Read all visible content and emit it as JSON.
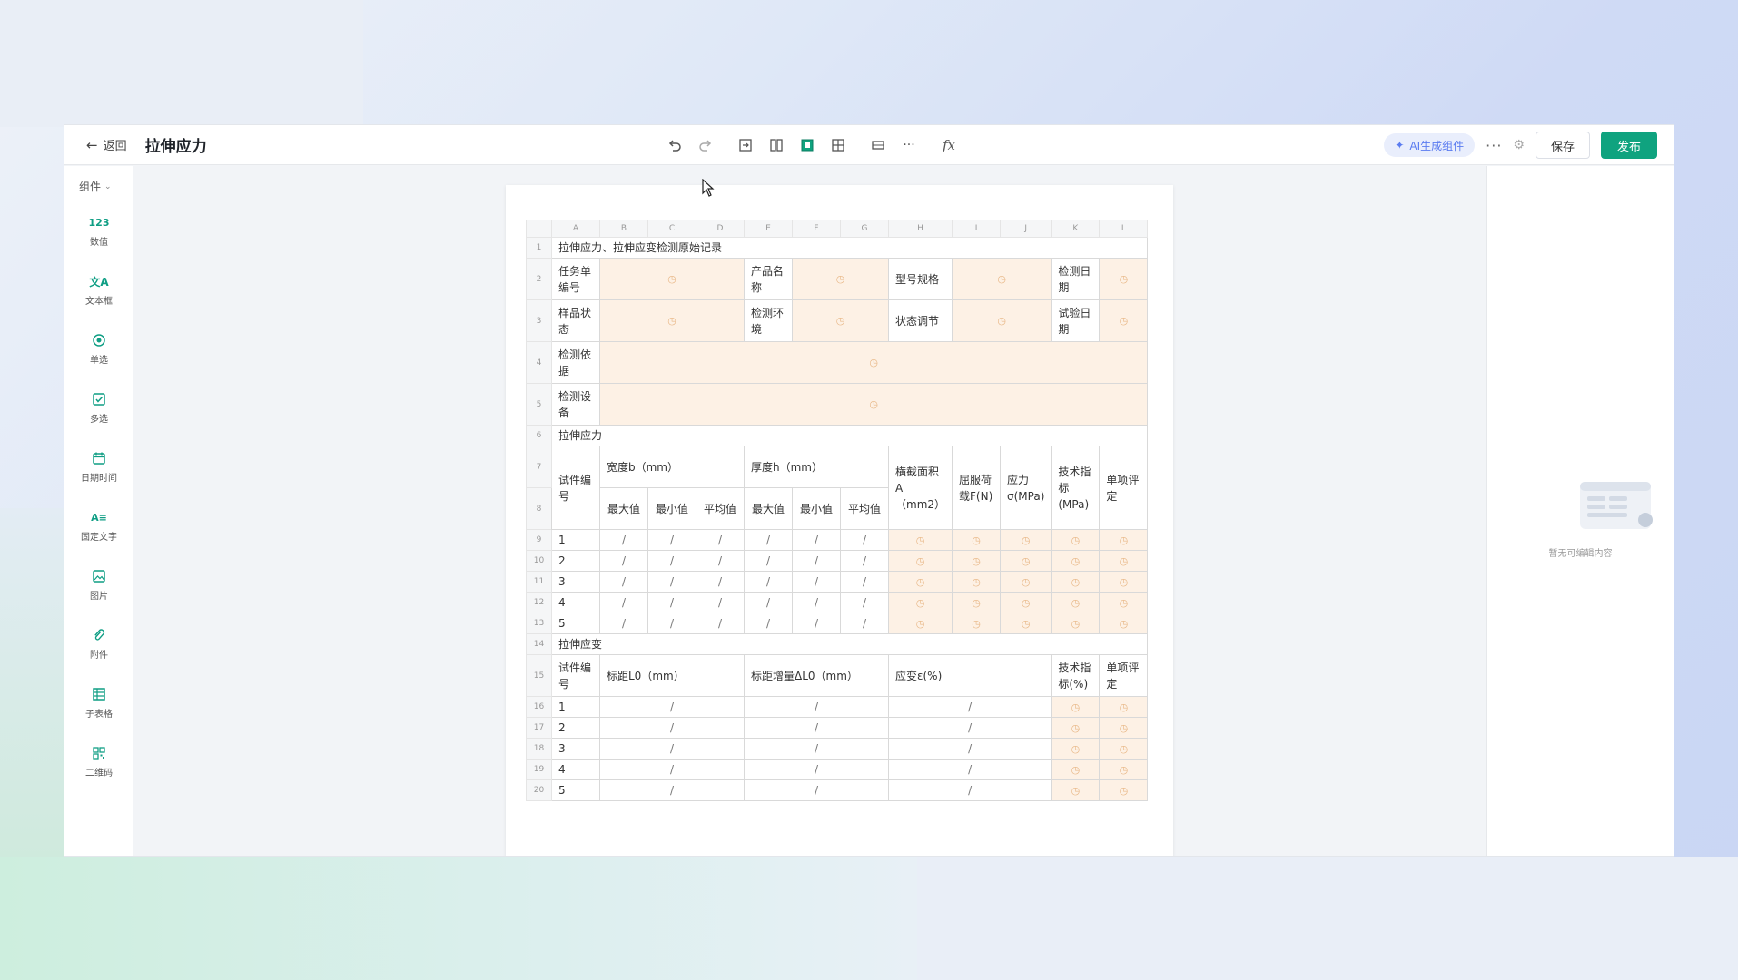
{
  "header": {
    "back_label": "返回",
    "title": "拉伸应力",
    "ai_label": "AI生成组件",
    "save_label": "保存",
    "publish_label": "发布"
  },
  "sidebar": {
    "group_label": "组件",
    "items": [
      {
        "label": "数值",
        "icon": "123"
      },
      {
        "label": "文本框",
        "icon": "文A"
      },
      {
        "label": "单选",
        "icon": "radio-icon"
      },
      {
        "label": "多选",
        "icon": "checkbox-icon"
      },
      {
        "label": "日期时间",
        "icon": "calendar-icon"
      },
      {
        "label": "固定文字",
        "icon": "A≡"
      },
      {
        "label": "图片",
        "icon": "image-icon"
      },
      {
        "label": "附件",
        "icon": "paperclip-icon"
      },
      {
        "label": "子表格",
        "icon": "subtable-icon"
      },
      {
        "label": "二维码",
        "icon": "qrcode-icon"
      }
    ]
  },
  "right_panel": {
    "empty_text": "暂无可编辑内容"
  },
  "sheet": {
    "columns": [
      "A",
      "B",
      "C",
      "D",
      "E",
      "F",
      "G",
      "H",
      "I",
      "J",
      "K",
      "L"
    ],
    "rows": [
      "1",
      "2",
      "3",
      "4",
      "5",
      "6",
      "7",
      "8",
      "9",
      "10",
      "11",
      "12",
      "13",
      "14",
      "15",
      "16",
      "17",
      "18",
      "19",
      "20"
    ],
    "title": "拉伸应力、拉伸应变检测原始记录",
    "task_no": "任务单编号",
    "product_name": "产品名称",
    "model_spec": "型号规格",
    "test_date": "检测日期",
    "sample_state": "样品状态",
    "test_env": "检测环境",
    "conditioning": "状态调节",
    "trial_date": "试验日期",
    "test_basis": "检测依据",
    "test_equipment": "检测设备",
    "section_stress": "拉伸应力",
    "specimen_no": "试件编号",
    "width": "宽度b（mm）",
    "thickness": "厚度h（mm）",
    "cross_section": "横截面积A（mm2）",
    "yield_load": "屈服荷载F(N)",
    "stress": "应力σ(MPa)",
    "tech_index_mpa": "技术指标(MPa)",
    "item_eval": "单项评定",
    "max": "最大值",
    "min": "最小值",
    "avg": "平均值",
    "section_strain": "拉伸应变",
    "specimen_no2": "试件编号",
    "gauge_length": "标距L0（mm）",
    "gauge_increment": "标距增量ΔL0（mm）",
    "strain": "应变ε(%)",
    "tech_index_pct": "技术指标(%)",
    "item_eval2": "单项评定",
    "specimens": [
      "1",
      "2",
      "3",
      "4",
      "5"
    ],
    "slash": "/",
    "field_icon": "clock-icon"
  },
  "colors": {
    "accent": "#0fa37f",
    "field_fill": "#fdf1e5",
    "ai_blue": "#5b7cf0"
  }
}
